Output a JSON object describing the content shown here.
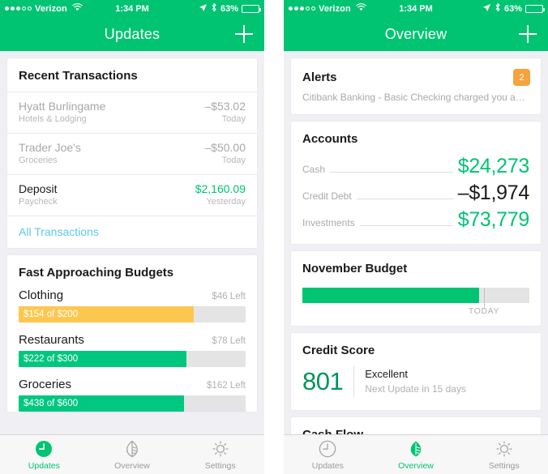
{
  "status_bar": {
    "carrier": "Verizon",
    "signal_dots_filled": 3,
    "signal_dots_total": 5,
    "wifi_icon": "wifi-icon",
    "time": "1:34 PM",
    "location_icon": "location-arrow-icon",
    "bluetooth_icon": "bluetooth-icon",
    "battery_percent": "63%",
    "battery_level": 63
  },
  "left_screen": {
    "nav": {
      "title": "Updates",
      "add_icon": "plus-icon"
    },
    "transactions_card": {
      "title": "Recent Transactions",
      "rows": [
        {
          "name": "Hyatt Burlingame",
          "category": "Hotels & Lodging",
          "amount": "–$53.02",
          "date": "Today",
          "highlight": false
        },
        {
          "name": "Trader Joe's",
          "category": "Groceries",
          "amount": "–$50.00",
          "date": "Today",
          "highlight": false
        },
        {
          "name": "Deposit",
          "category": "Paycheck",
          "amount": "$2,160.09",
          "date": "Yesterday",
          "highlight": true
        }
      ],
      "footer_link": "All Transactions"
    },
    "budgets_card": {
      "title": "Fast Approaching Budgets",
      "items": [
        {
          "name": "Clothing",
          "left": "$46 Left",
          "progress_label": "$154 of $200",
          "percent": 77,
          "color": "#fdc74f"
        },
        {
          "name": "Restaurants",
          "left": "$78 Left",
          "progress_label": "$222 of $300",
          "percent": 74,
          "color": "#00c77f"
        },
        {
          "name": "Groceries",
          "left": "$162 Left",
          "progress_label": "$438 of $600",
          "percent": 73,
          "color": "#00c77f"
        }
      ]
    },
    "tabs": [
      {
        "label": "Updates",
        "icon": "clock-icon",
        "active": true
      },
      {
        "label": "Overview",
        "icon": "leaf-icon",
        "active": false
      },
      {
        "label": "Settings",
        "icon": "gear-icon",
        "active": false
      }
    ]
  },
  "right_screen": {
    "nav": {
      "title": "Overview",
      "add_icon": "plus-icon"
    },
    "alerts_card": {
      "title": "Alerts",
      "badge_count": "2",
      "message": "Citibank Banking - Basic Checking charged you an ATM…"
    },
    "accounts_card": {
      "title": "Accounts",
      "rows": [
        {
          "label": "Cash",
          "value": "$24,273",
          "negative": false
        },
        {
          "label": "Credit Debt",
          "value": "–$1,974",
          "negative": true
        },
        {
          "label": "Investments",
          "value": "$73,779",
          "negative": false
        }
      ]
    },
    "month_budget_card": {
      "title": "November Budget",
      "progress_percent": 78,
      "today_marker_percent": 80,
      "today_label": "TODAY"
    },
    "credit_score_card": {
      "title": "Credit Score",
      "score": "801",
      "rating": "Excellent",
      "next_update": "Next Update in 15 days"
    },
    "cash_flow_card": {
      "title": "Cash Flow"
    },
    "tabs": [
      {
        "label": "Updates",
        "icon": "clock-icon",
        "active": false
      },
      {
        "label": "Overview",
        "icon": "leaf-icon",
        "active": true
      },
      {
        "label": "Settings",
        "icon": "gear-icon",
        "active": false
      }
    ]
  },
  "theme": {
    "green": "#00c472",
    "green_dark": "#00955c",
    "orange": "#f5a33c",
    "yellow": "#fdc74f",
    "link_blue": "#5bc8e8",
    "background": "#efeff4"
  }
}
